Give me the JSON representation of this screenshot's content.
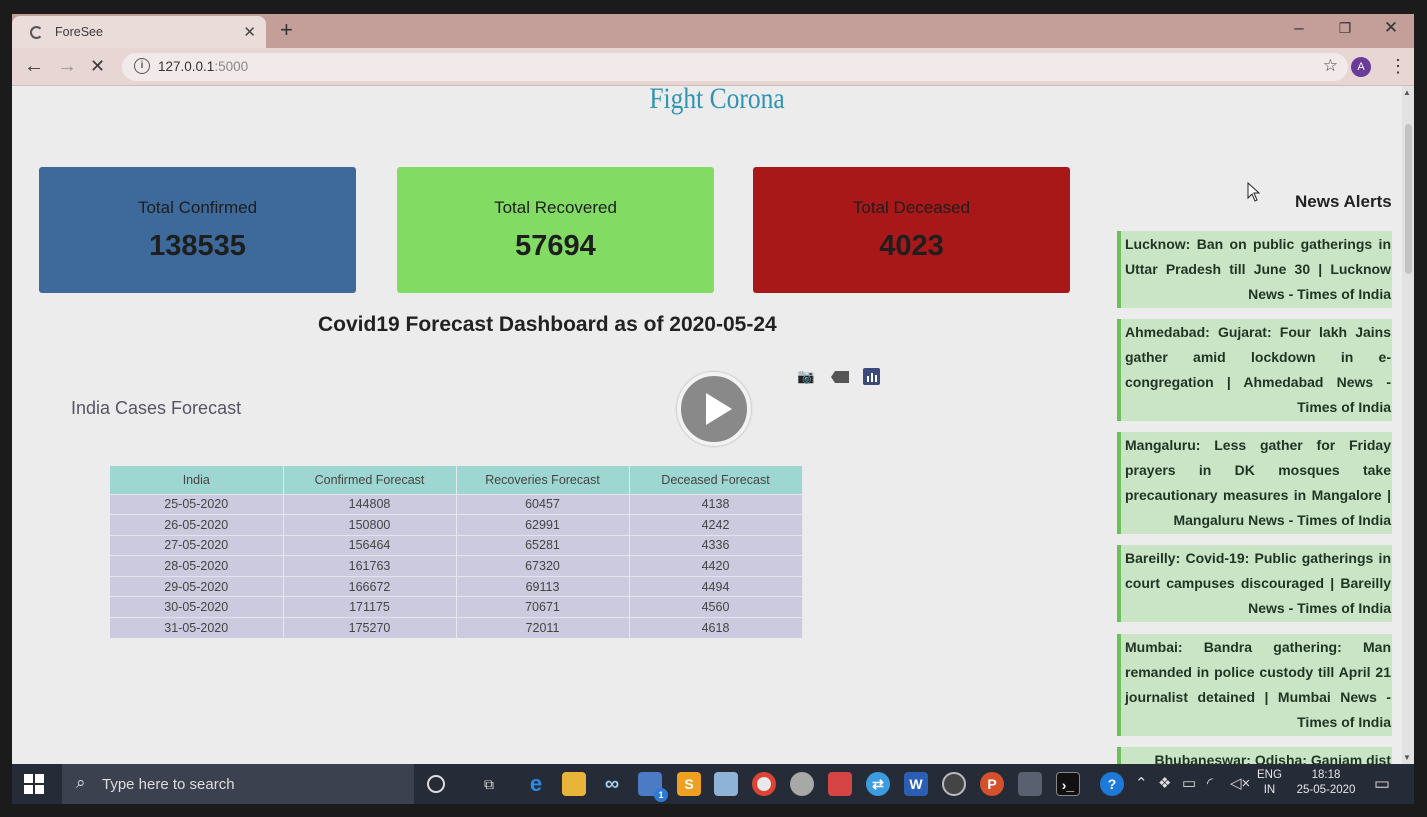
{
  "browser": {
    "tab_title": "ForeSee",
    "url_host": "127.0.0.1",
    "url_port": ":5000",
    "avatar_letter": "A"
  },
  "page": {
    "title": "Fight Corona",
    "stats": [
      {
        "label": "Total Confirmed",
        "value": "138535",
        "color": "#3d6a9a"
      },
      {
        "label": "Total Recovered",
        "value": "57694",
        "color": "#82dc64"
      },
      {
        "label": "Total Deceased",
        "value": "4023",
        "color": "#a81818"
      }
    ],
    "dashboard_title": "Covid19 Forecast Dashboard as of 2020-05-24",
    "chart_title": "India Cases Forecast",
    "table": {
      "headers": [
        "India",
        "Confirmed Forecast",
        "Recoveries Forecast",
        "Deceased Forecast"
      ],
      "rows": [
        [
          "25-05-2020",
          "144808",
          "60457",
          "4138"
        ],
        [
          "26-05-2020",
          "150800",
          "62991",
          "4242"
        ],
        [
          "27-05-2020",
          "156464",
          "65281",
          "4336"
        ],
        [
          "28-05-2020",
          "161763",
          "67320",
          "4420"
        ],
        [
          "29-05-2020",
          "166672",
          "69113",
          "4494"
        ],
        [
          "30-05-2020",
          "171175",
          "70671",
          "4560"
        ],
        [
          "31-05-2020",
          "175270",
          "72011",
          "4618"
        ]
      ]
    }
  },
  "news": {
    "title": "News Alerts",
    "items": [
      "Lucknow: Ban on public gatherings in Uttar Pradesh till June 30 | Lucknow News - Times of India",
      "Ahmedabad: Gujarat: Four lakh Jains gather amid lockdown in e-congregation | Ahmedabad News - Times of India",
      "Mangaluru: Less gather for Friday prayers in DK mosques take precautionary measures in Mangalore | Mangaluru News - Times of India",
      "Bareilly: Covid-19: Public gatherings in court campuses discouraged | Bareilly News - Times of India",
      "Mumbai: Bandra gathering: Man remanded in police custody till April 21 journalist detained | Mumbai News - Times of India",
      "Bhubaneswar: Odisha: Ganjam dist"
    ]
  },
  "taskbar": {
    "search_placeholder": "Type here to search",
    "lang": "ENG",
    "region": "IN",
    "time": "18:18",
    "date": "25-05-2020",
    "mail_badge": "1"
  }
}
